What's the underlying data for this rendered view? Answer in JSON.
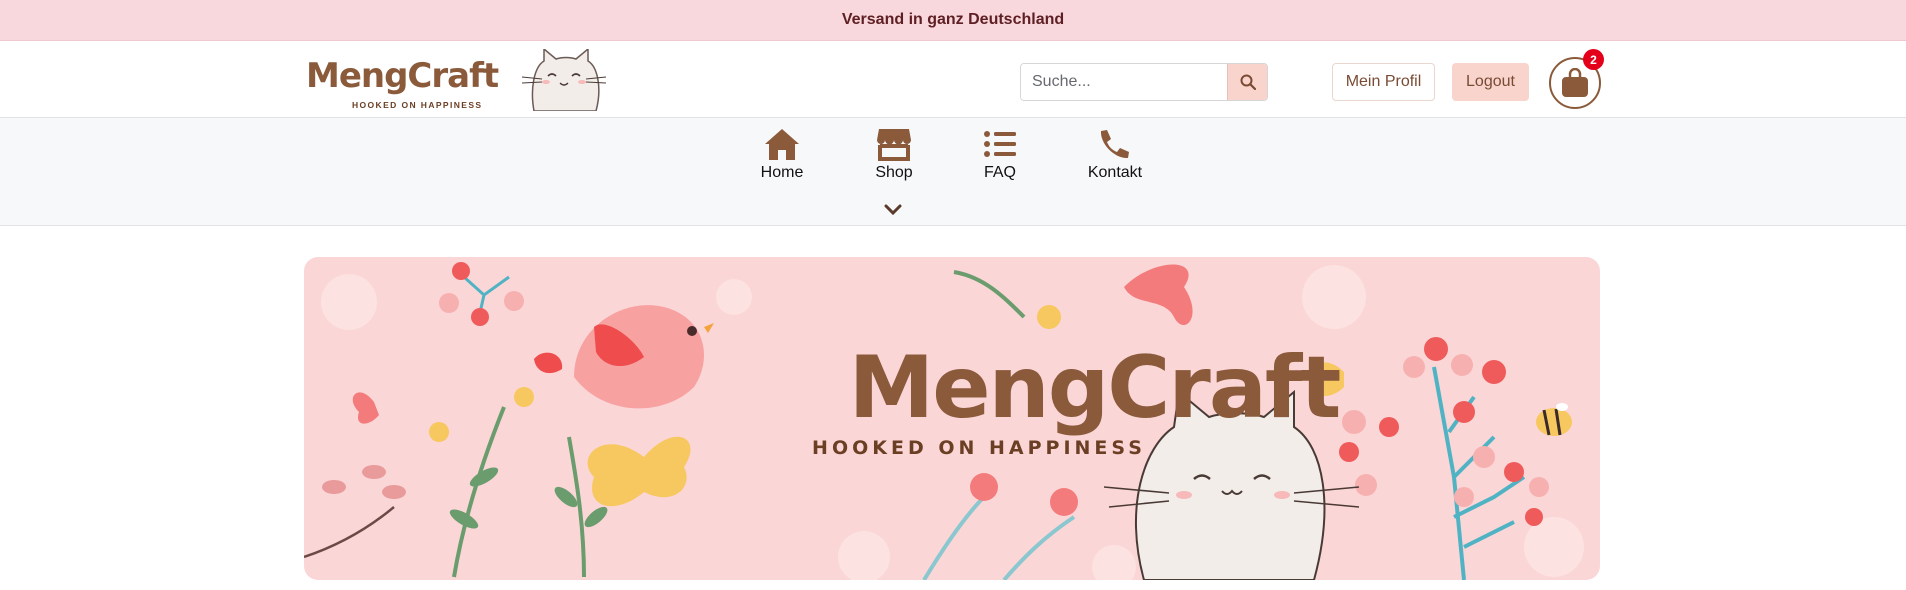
{
  "announcement": {
    "text": "Versand in ganz Deutschland"
  },
  "brand": {
    "name": "MengCraft",
    "tagline": "HOOKED ON HAPPINESS",
    "color": "#8a5a3b"
  },
  "search": {
    "placeholder": "Suche...",
    "icon": "search-icon"
  },
  "header": {
    "profile_label": "Mein Profil",
    "logout_label": "Logout"
  },
  "cart": {
    "icon": "shopping-bag-icon",
    "count": "2"
  },
  "nav": {
    "items": [
      {
        "label": "Home",
        "icon": "home-icon"
      },
      {
        "label": "Shop",
        "icon": "store-icon"
      },
      {
        "label": "FAQ",
        "icon": "list-icon"
      },
      {
        "label": "Kontakt",
        "icon": "phone-icon"
      }
    ],
    "expand_icon": "chevron-down-icon"
  },
  "banner": {
    "title": "MengCraft",
    "subtitle": "HOOKED ON HAPPINESS"
  },
  "colors": {
    "announcement_bg": "#f8d8dc",
    "accent": "#f8d4cc",
    "brown": "#8a5a3b",
    "badge": "#e4001b",
    "banner_bg": "#fbd6d7"
  }
}
